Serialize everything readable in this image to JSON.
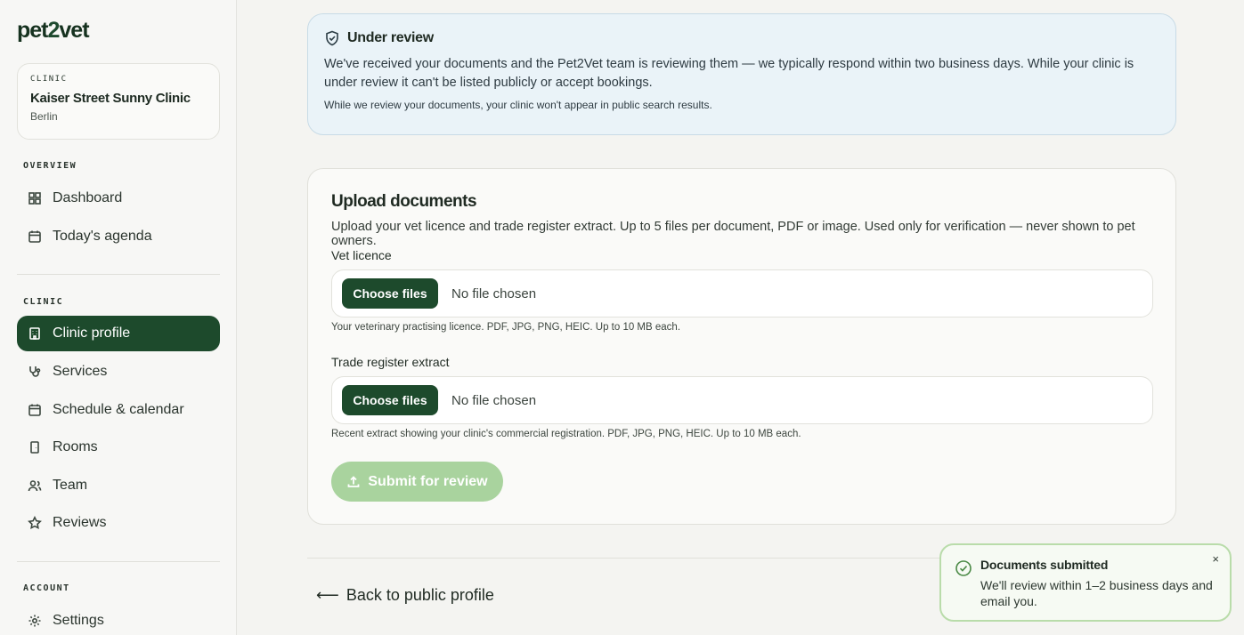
{
  "brand": {
    "logo_pre": "pet",
    "logo_mid": "2",
    "logo_post": "vet"
  },
  "clinic_card": {
    "eyebrow": "CLINIC",
    "name": "Kaiser Street Sunny Clinic",
    "city": "Berlin"
  },
  "sidebar": {
    "overview_label": "OVERVIEW",
    "clinic_label": "CLINIC",
    "account_label": "ACCOUNT",
    "items": [
      {
        "label": "Dashboard",
        "icon": "dashboard-icon"
      },
      {
        "label": "Today's agenda",
        "icon": "calendar-icon"
      },
      {
        "label": "Clinic profile",
        "icon": "building-icon",
        "active": true
      },
      {
        "label": "Services",
        "icon": "stethoscope-icon"
      },
      {
        "label": "Schedule & calendar",
        "icon": "calendar-icon"
      },
      {
        "label": "Rooms",
        "icon": "door-icon"
      },
      {
        "label": "Team",
        "icon": "users-icon"
      },
      {
        "label": "Reviews",
        "icon": "star-icon"
      },
      {
        "label": "Settings",
        "icon": "gear-icon"
      }
    ]
  },
  "review_banner": {
    "title": "Under review",
    "body": "We've received your documents and the Pet2Vet team is reviewing them — we typically respond within two business days. While your clinic is under review it can't be listed publicly or accept bookings.",
    "note": "While we review your documents, your clinic won't appear in public search results."
  },
  "upload": {
    "title": "Upload documents",
    "description": "Upload your vet licence and trade register extract. Up to 5 files per document, PDF or image. Used only for verification — never shown to pet owners.",
    "fields": [
      {
        "label": "Vet licence",
        "button": "Choose files",
        "status": "No file chosen",
        "help": "Your veterinary practising licence. PDF, JPG, PNG, HEIC. Up to 10 MB each."
      },
      {
        "label": "Trade register extract",
        "button": "Choose files",
        "status": "No file chosen",
        "help": "Recent extract showing your clinic's commercial registration. PDF, JPG, PNG, HEIC. Up to 10 MB each."
      }
    ],
    "submit_label": "Submit for review"
  },
  "back_link": {
    "arrow": "⟵",
    "label": "Back to public profile"
  },
  "toast": {
    "title": "Documents submitted",
    "message": "We'll review within 1–2 business days and email you.",
    "close": "×"
  },
  "colors": {
    "primary": "#1d4a2c",
    "banner_bg": "#eaf3f8",
    "toast_border": "#b9dcaa",
    "submit_disabled": "#a9d39e"
  }
}
